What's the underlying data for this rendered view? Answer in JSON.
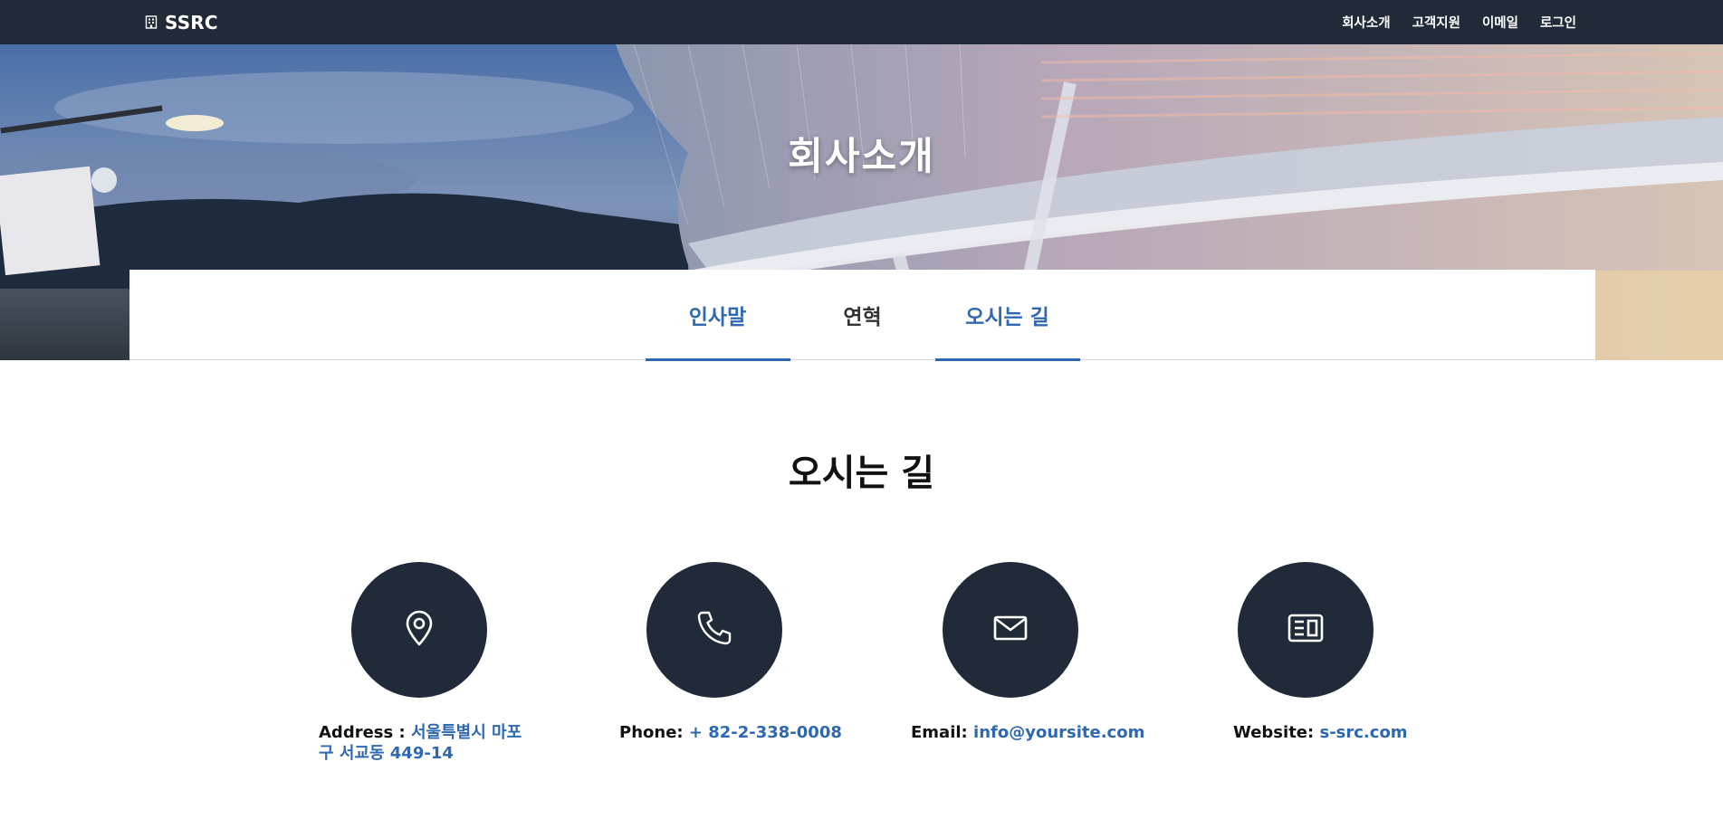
{
  "navbar": {
    "brand": "SSRC",
    "links": [
      "회사소개",
      "고객지원",
      "이메일",
      "로그인"
    ]
  },
  "hero": {
    "title": "회사소개"
  },
  "tabs": [
    {
      "label": "인사말",
      "active": true
    },
    {
      "label": "연혁",
      "active": false
    },
    {
      "label": "오시는 길",
      "active": true
    }
  ],
  "section": {
    "title": "오시는 길"
  },
  "contacts": {
    "address": {
      "label": "Address :",
      "value": "서울특별시 마포구 서교동 449-14",
      "icon": "map-pin-icon"
    },
    "phone": {
      "label": "Phone:",
      "value": "+ 82-2-338-0008",
      "icon": "phone-icon"
    },
    "email": {
      "label": "Email:",
      "value": "info@yoursite.com",
      "icon": "mail-icon"
    },
    "website": {
      "label": "Website:",
      "value": "s-src.com",
      "icon": "newspaper-icon"
    }
  },
  "colors": {
    "navbar_bg": "#212a38",
    "accent": "#2e68b1",
    "circle_bg": "#212a38"
  }
}
